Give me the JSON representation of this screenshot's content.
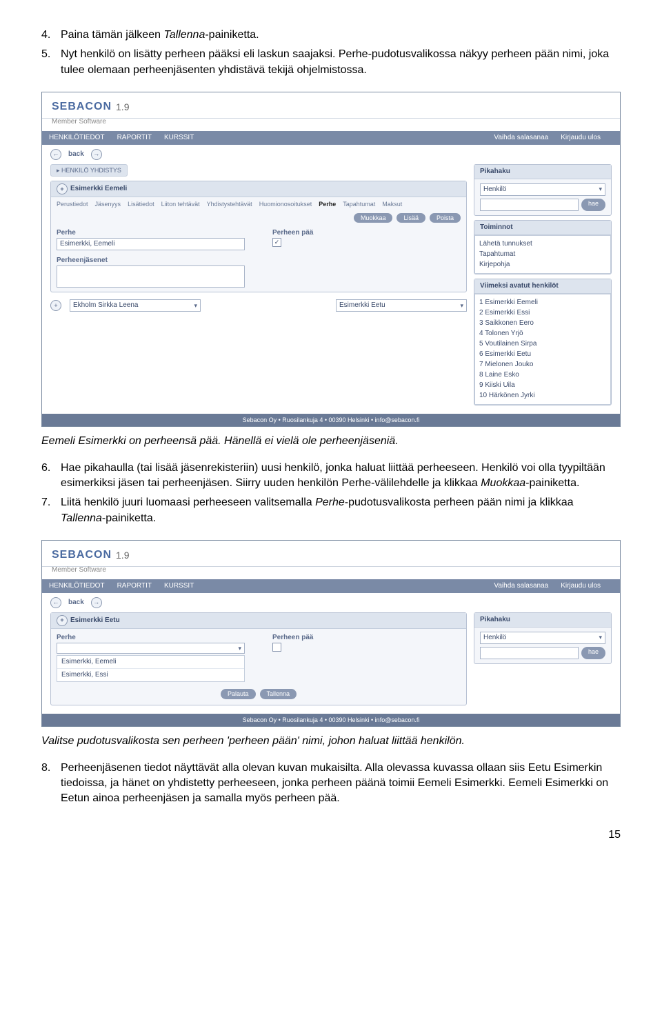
{
  "steps_top": [
    {
      "n": "4.",
      "t_pre": "Paina tämän jälkeen ",
      "em": "Tallenna",
      "t_post": "-painiketta."
    },
    {
      "n": "5.",
      "t_pre": "Nyt henkilö on lisätty perheen pääksi eli laskun saajaksi. Perhe-pudotusvalikossa näkyy perheen pään nimi, joka tulee olemaan perheenjäsenten yhdistävä tekijä ohjelmistossa.",
      "em": "",
      "t_post": ""
    }
  ],
  "caption1": "Eemeli Esimerkki on perheensä pää. Hänellä ei vielä ole perheenjäseniä.",
  "steps_mid": [
    {
      "n": "6.",
      "html": "Hae pikahaulla (tai lisää jäsenrekisteriin) uusi henkilö, jonka haluat liittää perheeseen. Henkilö voi olla tyypiltään esimerkiksi jäsen tai perheenjäsen. Siirry uuden henkilön Perhe-välilehdelle ja klikkaa <em>Muokkaa</em>-painiketta."
    },
    {
      "n": "7.",
      "html": "Liitä henkilö juuri luomaasi perheeseen valitsemalla <em>Perhe</em>-pudotusvalikosta perheen pään nimi ja klikkaa <em>Tallenna</em>-painiketta."
    }
  ],
  "caption2": "Valitse pudotusvalikosta sen perheen 'perheen pään' nimi, johon haluat liittää henkilön.",
  "steps_bot": [
    {
      "n": "8.",
      "html": "Perheenjäsenen tiedot näyttävät alla olevan kuvan mukaisilta. Alla olevassa kuvassa ollaan siis Eetu Esimerkin tiedoissa, ja hänet on yhdistetty perheeseen, jonka perheen päänä toimii Eemeli Esimerkki. Eemeli Esimerkki on Eetun ainoa perheenjäsen ja samalla myös perheen pää."
    }
  ],
  "page_num": "15",
  "ss": {
    "logo": "SEBAC",
    "logo2": "ON",
    "ver": "1.9",
    "sub": "Member Software",
    "nav": [
      "HENKILÖTIEDOT",
      "RAPORTIT",
      "KURSSIT"
    ],
    "nav_r": [
      "Vaihda salasanaa",
      "Kirjaudu ulos"
    ],
    "back": "back",
    "crumb": "▸ HENKILÖ    YHDISTYS",
    "tabs": [
      "Perustiedot",
      "Jäsenyys",
      "Lisätiedot",
      "Liiton tehtävät",
      "Yhdistystehtävät",
      "Huomionosoitukset",
      "Perhe",
      "Tapahtumat",
      "Maksut"
    ],
    "btns": [
      "Muokkaa",
      "Lisää",
      "Poista"
    ],
    "lbl_perhe": "Perhe",
    "lbl_paa": "Perheen pää",
    "lbl_jasenet": "Perheenjäsenet",
    "footer": "Sebacon Oy • Ruosilankuja 4 • 00390 Helsinki • info@sebacon.fi",
    "pikahaku": "Pikahaku",
    "henkilo": "Henkilö",
    "hae": "hae",
    "toiminnot": "Toiminnot",
    "toim_items": [
      "Lähetä tunnukset",
      "Tapahtumat",
      "Kirjepohja"
    ],
    "viimeksi": "Viimeksi avatut henkilöt",
    "recent": [
      "1 Esimerkki Eemeli",
      "2 Esimerkki Essi",
      "3 Saikkonen Eero",
      "4 Tolonen Yrjö",
      "5 Voutilainen Sirpa",
      "6 Esimerkki Eetu",
      "7 Mielonen Jouko",
      "8 Laine Esko",
      "9 Kiiski Uila",
      "10 Härkönen Jyrki"
    ]
  },
  "ss1": {
    "person": "Esimerkki Eemeli",
    "perhe_val": "Esimerkki, Eemeli",
    "bottom_sel1": "Ekholm Sirkka Leena",
    "bottom_sel2": "Esimerkki Eetu"
  },
  "ss2": {
    "person": "Esimerkki Eetu",
    "perhe_val": "",
    "btns": [
      "Palauta",
      "Tallenna"
    ],
    "list": [
      "Esimerkki, Eemeli",
      "Esimerkki, Essi"
    ]
  }
}
